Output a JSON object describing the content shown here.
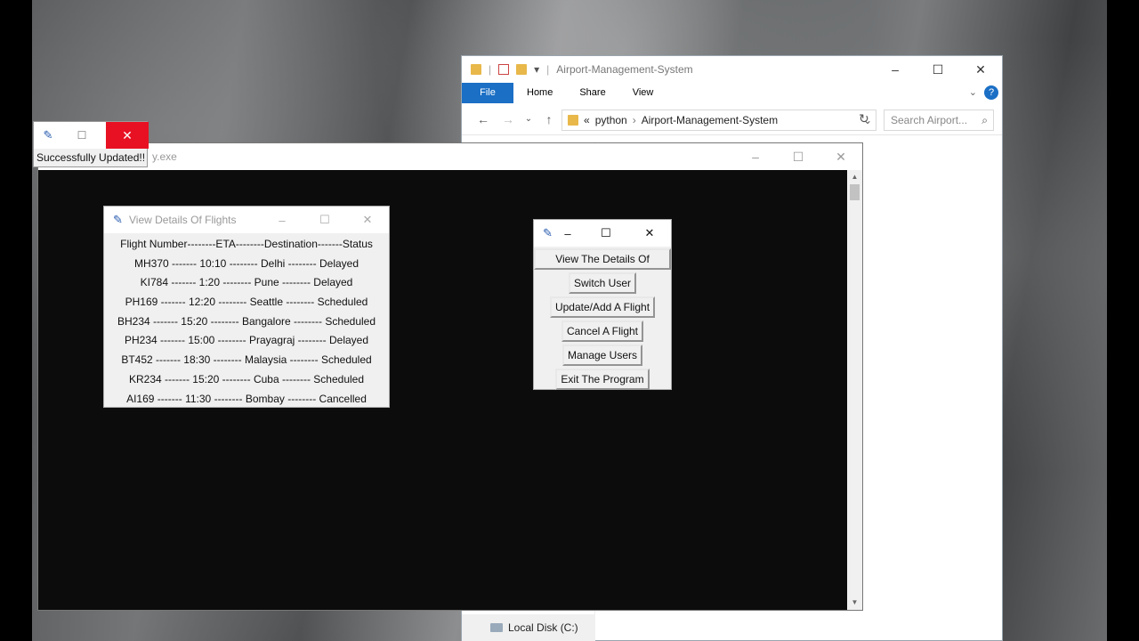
{
  "explorer": {
    "title": "Airport-Management-System",
    "ribbon_tabs": [
      "File",
      "Home",
      "Share",
      "View"
    ],
    "help": "?",
    "path": [
      "python",
      "Airport-Management-System"
    ],
    "path_prefix": "«",
    "search_placeholder": "Search Airport...",
    "local_disk": "Local Disk (C:)"
  },
  "console": {
    "title": "y.exe"
  },
  "flights_window": {
    "title": "View Details Of Flights",
    "header": "Flight Number--------ETA--------Destination-------Status",
    "rows": [
      "MH370 ------- 10:10 -------- Delhi -------- Delayed",
      "KI784 ------- 1:20 -------- Pune -------- Delayed",
      "PH169 ------- 12:20 -------- Seattle -------- Scheduled",
      "BH234 ------- 15:20 -------- Bangalore -------- Scheduled",
      "PH234 ------- 15:00 -------- Prayagraj -------- Delayed",
      "BT452 ------- 18:30 -------- Malaysia -------- Scheduled",
      "KR234 ------- 15:20 -------- Cuba -------- Scheduled",
      "AI169 ------- 11:30 -------- Bombay -------- Cancelled"
    ]
  },
  "menu_window": {
    "buttons": {
      "view": "View The Details Of Flights",
      "switch_user": "Switch User",
      "update_add": "Update/Add A Flight",
      "cancel": "Cancel A Flight",
      "manage": "Manage Users",
      "exit": "Exit The Program"
    }
  },
  "popup": {
    "message": "Successfully Updated!!"
  },
  "colors": {
    "accent": "#1b6fc5",
    "close_red": "#e81123"
  }
}
